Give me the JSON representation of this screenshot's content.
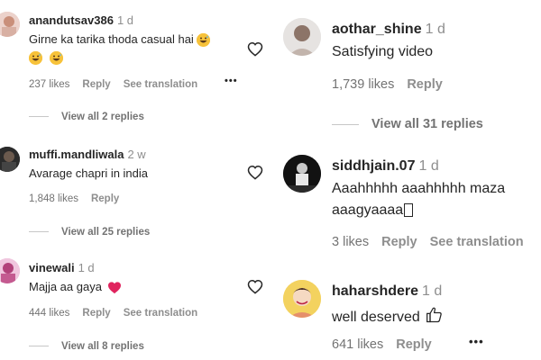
{
  "left_comments": [
    {
      "username": "anandutsav386",
      "time": "1 d",
      "text": "Girne ka tarika thoda casual hai",
      "likes": "237 likes",
      "reply": "Reply",
      "translation": "See translation",
      "view_replies": "View all 2 replies"
    },
    {
      "username": "muffi.mandliwala",
      "time": "2 w",
      "text": "Avarage chapri in india",
      "likes": "1,848 likes",
      "reply": "Reply",
      "view_replies": "View all 25 replies"
    },
    {
      "username": "vinewali",
      "time": "1 d",
      "text": "Majja aa gaya",
      "likes": "444 likes",
      "reply": "Reply",
      "translation": "See translation",
      "view_replies": "View all 8 replies"
    }
  ],
  "right_comments": [
    {
      "username": "aothar_shine",
      "time": "1 d",
      "text": "Satisfying video",
      "likes": "1,739 likes",
      "reply": "Reply",
      "view_replies": "View all 31 replies"
    },
    {
      "username": "siddhjain.07",
      "time": "1 d",
      "text_line1": "Aaahhhhh aaahhhhh maza",
      "text_line2": "aaagyaaaa",
      "likes": "3 likes",
      "reply": "Reply",
      "translation": "See translation"
    },
    {
      "username": "haharshdere",
      "time": "1 d",
      "text": "well deserved",
      "likes": "641 likes",
      "reply": "Reply"
    }
  ],
  "icons": {
    "more": "more-options-icon",
    "heart": "heart-outline-icon",
    "emoji_laugh": "grinning-sweat-emoji",
    "emoji_heart": "red-heart-emoji",
    "emoji_thumbs": "thumbs-up-emoji"
  },
  "more_glyph": "•••",
  "colors": {
    "text": "#262626",
    "secondary": "#8e8e8e",
    "heart_red": "#e0245e",
    "emoji_yellow": "#f7c23a"
  }
}
